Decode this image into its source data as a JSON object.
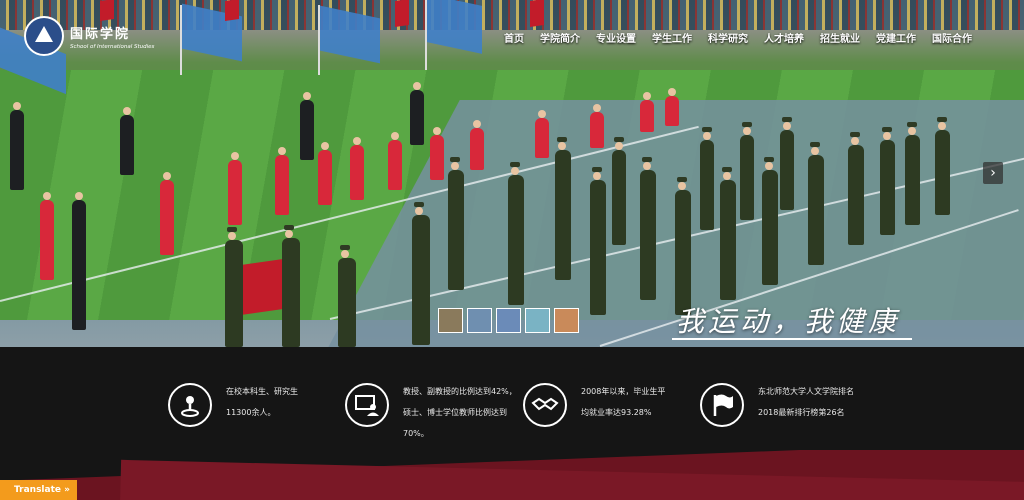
{
  "site": {
    "logo_cn": "国际学院",
    "logo_en": "School of International Studies"
  },
  "nav": [
    {
      "label": "首页"
    },
    {
      "label": "学院简介"
    },
    {
      "label": "专业设置"
    },
    {
      "label": "学生工作"
    },
    {
      "label": "科学研究"
    },
    {
      "label": "人才培养"
    },
    {
      "label": "招生就业"
    },
    {
      "label": "党建工作"
    },
    {
      "label": "国际合作"
    }
  ],
  "hero": {
    "slogan": "我运动，我健康",
    "next_arrow": "›",
    "thumbnail_colors": [
      "#8a7a5c",
      "#6f8fb0",
      "#6b8bb8",
      "#7ab3c4",
      "#c98a5a"
    ]
  },
  "stats": [
    {
      "icon": "person-pin-icon",
      "text": "在校本科生、研究生11300余人。"
    },
    {
      "icon": "teacher-board-icon",
      "text": "教授、副教授的比例达到42%，硕士、博士学位教师比例达到70%。"
    },
    {
      "icon": "handshake-icon",
      "text": "2008年以来，毕业生平均就业率达93.28%"
    },
    {
      "icon": "flag-icon",
      "text": "东北师范大学人文学院排名2018最新排行榜第26名"
    }
  ],
  "translate_label": "Translate »"
}
